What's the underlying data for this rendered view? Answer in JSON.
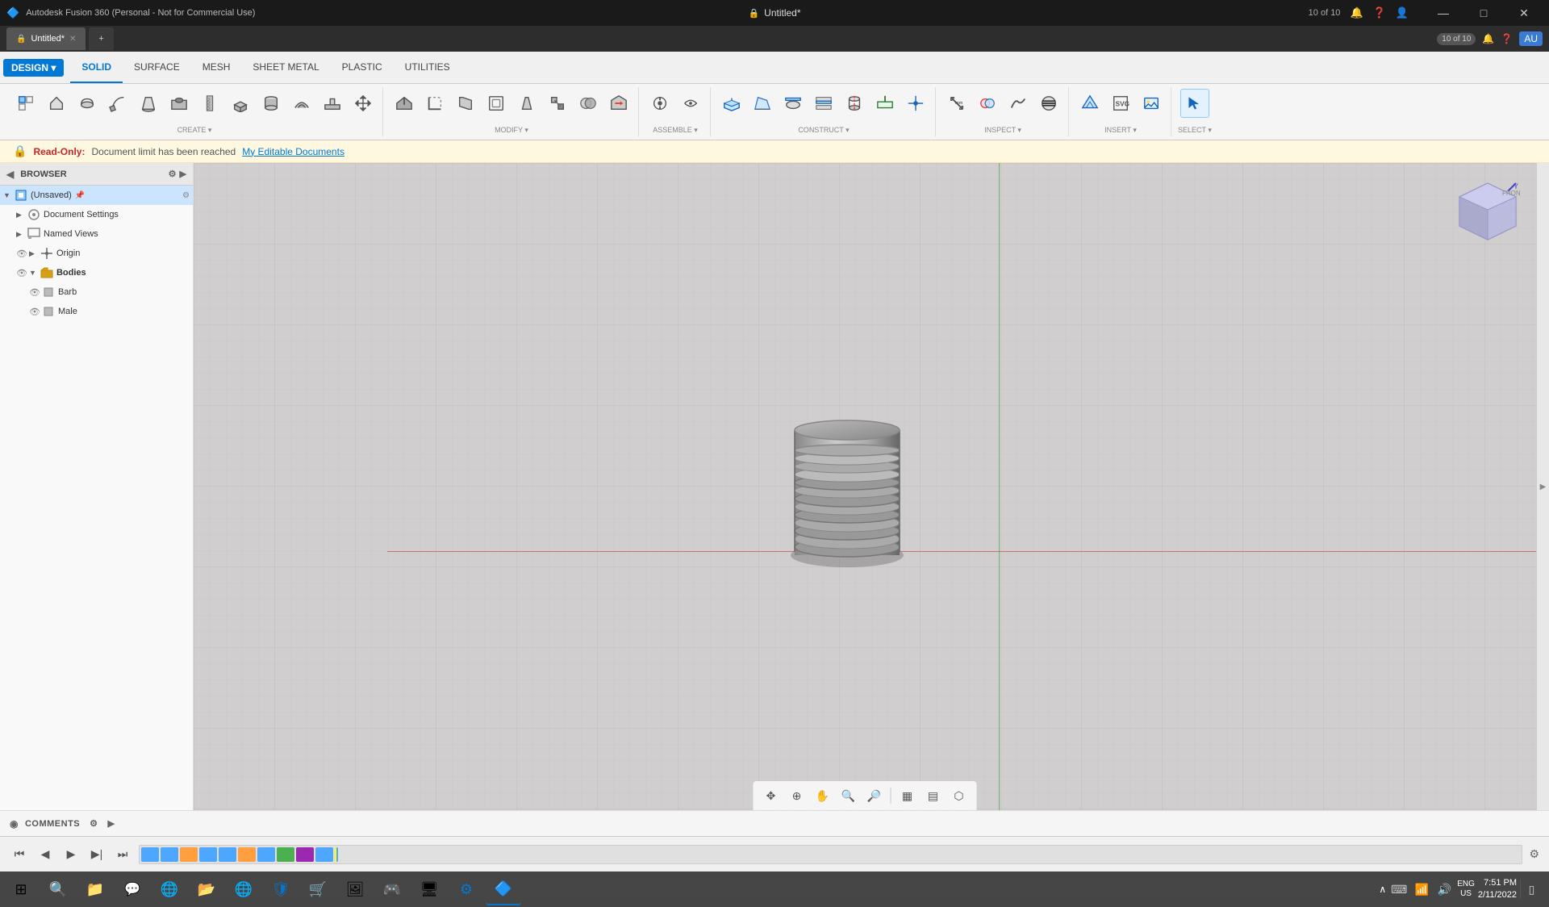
{
  "titlebar": {
    "app_title": "Autodesk Fusion 360 (Personal - Not for Commercial Use)",
    "logo": "🔷",
    "minimize": "—",
    "maximize": "□",
    "close": "✕"
  },
  "tabs": {
    "document_title": "Untitled*",
    "close_tab": "✕",
    "new_tab": "+",
    "document_count": "10 of 10"
  },
  "menu": {
    "design_label": "DESIGN ▾",
    "tabs": [
      "SOLID",
      "SURFACE",
      "MESH",
      "SHEET METAL",
      "PLASTIC",
      "UTILITIES"
    ],
    "active_tab": "SOLID"
  },
  "toolbar": {
    "groups": [
      {
        "label": "CREATE ▾",
        "icons": [
          "new-component",
          "extrude",
          "revolve",
          "sweep",
          "loft",
          "rib",
          "web",
          "emboss",
          "hole",
          "thread",
          "box",
          "cylinder"
        ]
      },
      {
        "label": "MODIFY ▾",
        "icons": [
          "press-pull",
          "fillet",
          "chamfer",
          "shell",
          "draft",
          "scale",
          "combine",
          "replace-face"
        ]
      },
      {
        "label": "ASSEMBLE ▾",
        "icons": [
          "joint",
          "motion-link"
        ]
      },
      {
        "label": "CONSTRUCT ▾",
        "icons": [
          "offset-plane",
          "plane-at-angle",
          "tangent-plane",
          "midplane",
          "axis-through-cylinder",
          "axis-perpendicular",
          "point"
        ]
      },
      {
        "label": "INSPECT ▾",
        "icons": [
          "measure",
          "interference",
          "curvature-comb",
          "zebra"
        ]
      },
      {
        "label": "INSERT ▾",
        "icons": [
          "insert-mesh",
          "insert-svg",
          "insert-image"
        ]
      },
      {
        "label": "SELECT ▾",
        "icons": [
          "select-arrow"
        ]
      }
    ]
  },
  "notification": {
    "lock_icon": "🔒",
    "readonly_label": "Read-Only:",
    "message": "Document limit has been reached",
    "link": "My Editable Documents"
  },
  "browser": {
    "title": "BROWSER",
    "items": [
      {
        "level": 0,
        "label": "(Unsaved)",
        "icon": "component",
        "arrow": "▶",
        "hasEye": false,
        "pinned": true
      },
      {
        "level": 1,
        "label": "Document Settings",
        "icon": "settings",
        "arrow": "▶",
        "hasEye": false
      },
      {
        "level": 1,
        "label": "Named Views",
        "icon": "views",
        "arrow": "▶",
        "hasEye": false
      },
      {
        "level": 1,
        "label": "Origin",
        "icon": "origin",
        "arrow": "▶",
        "hasEye": true
      },
      {
        "level": 1,
        "label": "Bodies",
        "icon": "bodies",
        "arrow": "▼",
        "hasEye": true
      },
      {
        "level": 2,
        "label": "Barb",
        "icon": "body",
        "arrow": "",
        "hasEye": true
      },
      {
        "level": 2,
        "label": "Male",
        "icon": "body",
        "arrow": "",
        "hasEye": true
      }
    ]
  },
  "viewport": {
    "background_color": "#d0cece"
  },
  "viewcube": {
    "label": "FRONT",
    "axis_y": "Y",
    "axis_x": "",
    "color_top": "#4444cc",
    "color_front": "#4444cc"
  },
  "comments": {
    "label": "COMMENTS",
    "settings_icon": "⚙",
    "expand_icon": "◉"
  },
  "timeline": {
    "items": [
      {
        "type": "blue",
        "count": 1
      },
      {
        "type": "blue",
        "count": 2
      },
      {
        "type": "orange",
        "count": 3
      },
      {
        "type": "blue",
        "count": 4
      },
      {
        "type": "green",
        "count": 5
      },
      {
        "type": "blue",
        "count": 6
      },
      {
        "type": "purple",
        "count": 7
      },
      {
        "type": "gray",
        "count": 8
      },
      {
        "type": "blue",
        "count": 9
      },
      {
        "type": "blue",
        "count": 10
      }
    ]
  },
  "taskbar": {
    "time": "7:51 PM",
    "date": "2/11/2022",
    "locale": "ENG\nUS",
    "icons": [
      "⊞",
      "🔍",
      "📁",
      "💬",
      "🌐",
      "📁",
      "🌐",
      "🛡",
      "🌐",
      "🔵",
      "🌐",
      "🎮",
      "🌐",
      "🖥",
      "🔧"
    ]
  }
}
